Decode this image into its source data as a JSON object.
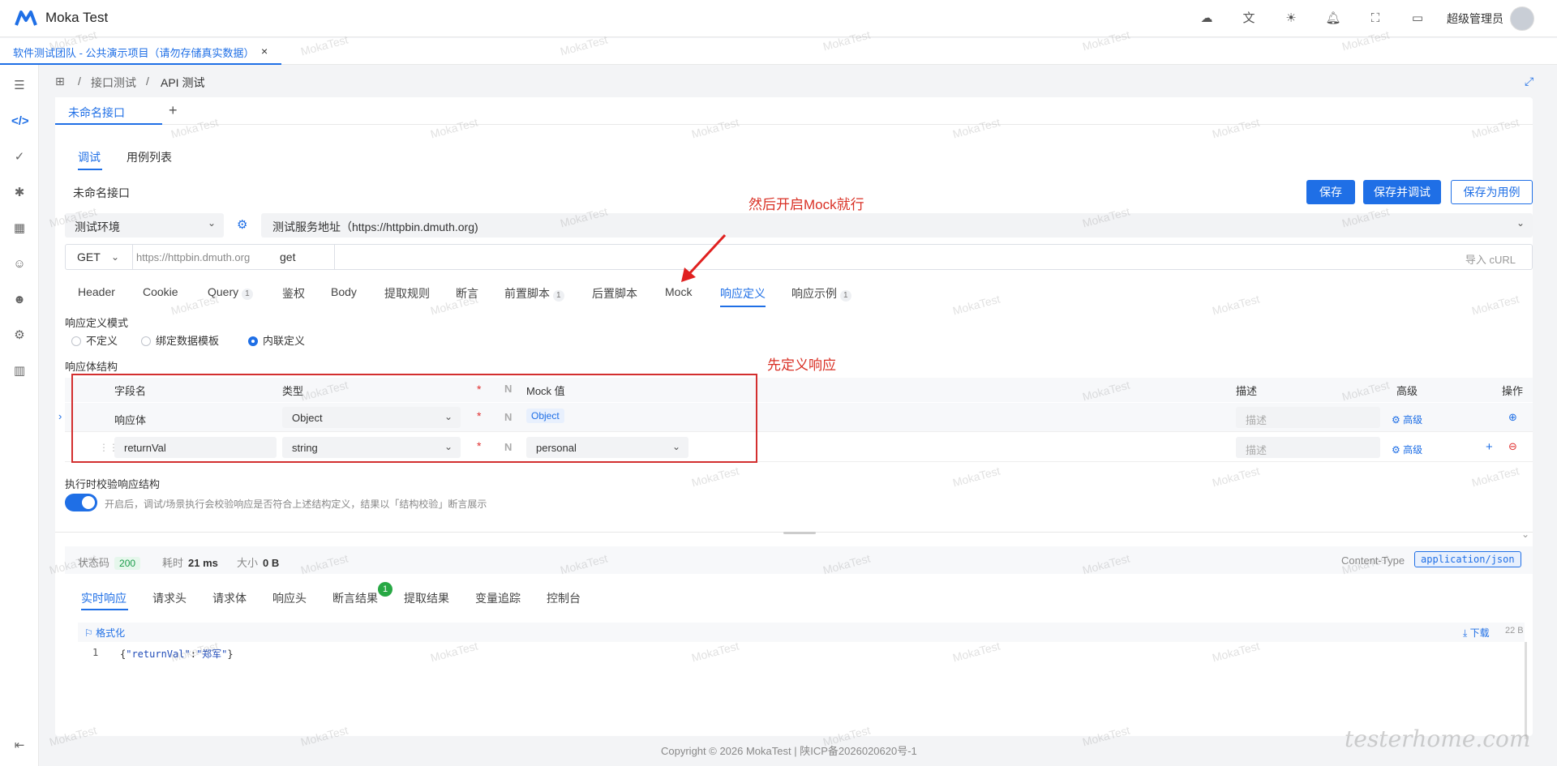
{
  "app": {
    "title": "Moka Test",
    "user_name": "超级管理员"
  },
  "project_tab": {
    "label": "软件测试团队 - 公共演示项目（请勿存储真实数据）",
    "close": "×"
  },
  "breadcrumb": {
    "sep": "/",
    "level1": "接口测试",
    "level2": "API 测试"
  },
  "file_tab": {
    "label": "未命名接口",
    "add": "+"
  },
  "sub_tabs": [
    "调试",
    "用例列表"
  ],
  "interface_name": "未命名接口",
  "buttons": {
    "save": "保存",
    "save_debug": "保存并调试",
    "save_case": "保存为用例"
  },
  "env": {
    "selected": "测试环境",
    "server": "测试服务地址（https://httpbin.dmuth.org)"
  },
  "request": {
    "method": "GET",
    "base_url": "https://httpbin.dmuth.org",
    "path": "get",
    "import_curl": "导入 cURL"
  },
  "request_tabs": [
    {
      "label": "Header"
    },
    {
      "label": "Cookie"
    },
    {
      "label": "Query",
      "badge": "1"
    },
    {
      "label": "鉴权"
    },
    {
      "label": "Body"
    },
    {
      "label": "提取规则"
    },
    {
      "label": "断言"
    },
    {
      "label": "前置脚本",
      "badge": "1"
    },
    {
      "label": "后置脚本"
    },
    {
      "label": "Mock"
    },
    {
      "label": "响应定义"
    },
    {
      "label": "响应示例",
      "badge": "1"
    }
  ],
  "response_def": {
    "mode_label": "响应定义模式",
    "modes": [
      "不定义",
      "绑定数据模板",
      "内联定义"
    ],
    "body_label": "响应体结构",
    "columns": {
      "field": "字段名",
      "type": "类型",
      "required": "*",
      "nullable": "N",
      "mock": "Mock 值",
      "desc": "描述",
      "adv": "高级",
      "op": "操作"
    },
    "rows": [
      {
        "field": "响应体",
        "type": "Object",
        "mock": "Object",
        "desc_placeholder": "描述",
        "adv": "高级"
      },
      {
        "field": "returnVal",
        "type": "string",
        "mock": "personal",
        "desc_placeholder": "描述",
        "adv": "高级"
      }
    ],
    "validate_label": "执行时校验响应结构",
    "validate_hint": "开启后，调试/场景执行会校验响应是否符合上述结构定义，结果以「结构校验」断言展示"
  },
  "annotations": {
    "mock_hint": "然后开启Mock就行",
    "define_hint": "先定义响应"
  },
  "response": {
    "status_label": "状态码",
    "status_code": "200",
    "time_label": "耗时",
    "time_value": "21 ms",
    "size_label": "大小",
    "size_value": "0 B",
    "content_type_label": "Content-Type",
    "content_type": "application/json",
    "tabs": [
      "实时响应",
      "请求头",
      "请求体",
      "响应头",
      "断言结果",
      "提取结果",
      "变量追踪",
      "控制台"
    ],
    "assert_badge": "1",
    "format_label": "格式化",
    "download_label": "下载",
    "size_small": "22 B",
    "line_no": "1",
    "code": {
      "open": "{",
      "key": "\"returnVal\"",
      "colon": ":",
      "value": "\"郑军\"",
      "close": "}"
    }
  },
  "footer": {
    "copyright": "Copyright © 2026 MokaTest",
    "sep": "|",
    "icp": "陕ICP备2026020620号-1"
  },
  "watermark": {
    "text": "MokaTest",
    "corner": "testerhome.com"
  },
  "colors": {
    "primary": "#1f6fe6",
    "annotation": "#d32f2f",
    "success": "#27a844"
  }
}
